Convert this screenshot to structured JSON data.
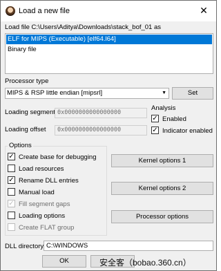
{
  "window": {
    "title": "Load a new file",
    "close_glyph": "✕"
  },
  "load_file_label": "Load file C:\\Users\\Aditya\\Downloads\\stack_bof_01 as",
  "file_types": [
    "ELF for MIPS (Executable) [elf64.l64]",
    "Binary file"
  ],
  "processor": {
    "label": "Processor type",
    "value": "MIPS & RSP little endian [mipsrl]",
    "set_label": "Set"
  },
  "loading_segment": {
    "label": "Loading segment",
    "value": "0x0000000000000000"
  },
  "loading_offset": {
    "label": "Loading offset",
    "value": "0x0000000000000000"
  },
  "analysis": {
    "title": "Analysis",
    "enabled": "Enabled",
    "indicator": "Indicator enabled"
  },
  "options": {
    "title": "Options",
    "items": [
      "Create base for debugging",
      "Load resources",
      "Rename DLL entries",
      "Manual load",
      "Fill segment gaps",
      "Loading options",
      "Create FLAT group"
    ],
    "kernel1": "Kernel options 1",
    "kernel2": "Kernel options 2",
    "processor_options": "Processor options"
  },
  "dll": {
    "label": "DLL directory",
    "value": "C:\\WINDOWS"
  },
  "ok_label": "OK",
  "watermark": "安全客（bobao.360.cn）"
}
